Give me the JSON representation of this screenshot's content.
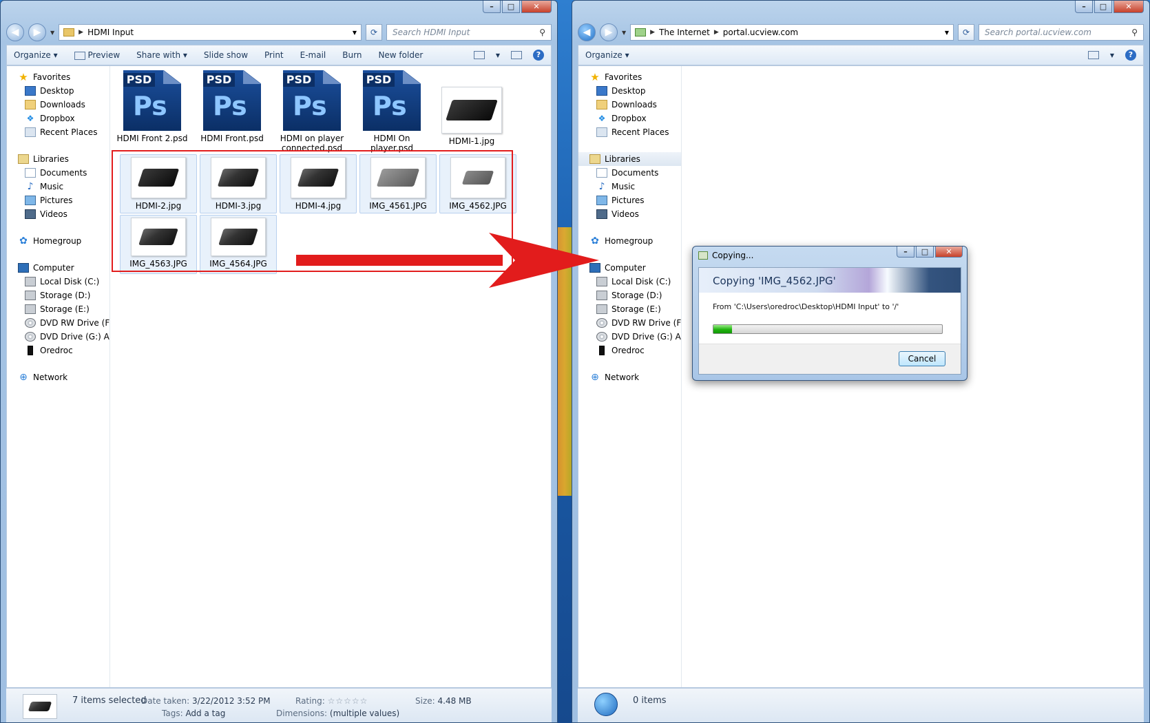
{
  "left": {
    "path": [
      "HDMI Input"
    ],
    "search_placeholder": "Search HDMI Input",
    "toolbar": [
      "Organize ▾",
      "Preview",
      "Share with ▾",
      "Slide show",
      "Print",
      "E-mail",
      "Burn",
      "New folder"
    ],
    "files_row1": [
      {
        "name": "HDMI Front 2.psd",
        "kind": "psd"
      },
      {
        "name": "HDMI Front.psd",
        "kind": "psd"
      },
      {
        "name": "HDMI on player connected.psd",
        "kind": "psd"
      },
      {
        "name": "HDMI On player.psd",
        "kind": "psd"
      },
      {
        "name": "HDMI-1.jpg",
        "kind": "jpg"
      }
    ],
    "files_selected": [
      {
        "name": "HDMI-2.jpg"
      },
      {
        "name": "HDMI-3.jpg"
      },
      {
        "name": "HDMI-4.jpg"
      },
      {
        "name": "IMG_4561.JPG"
      },
      {
        "name": "IMG_4562.JPG"
      },
      {
        "name": "IMG_4563.JPG"
      },
      {
        "name": "IMG_4564.JPG"
      }
    ],
    "status": {
      "selected": "7 items selected",
      "date_label": "Date taken:",
      "date_value": "3/22/2012 3:52 PM",
      "tags_label": "Tags:",
      "tags_value": "Add a tag",
      "rating_label": "Rating:",
      "rating_stars": "☆☆☆☆☆",
      "dims_label": "Dimensions:",
      "dims_value": "(multiple values)",
      "size_label": "Size:",
      "size_value": "4.48 MB"
    }
  },
  "right": {
    "path": [
      "The Internet",
      "portal.ucview.com"
    ],
    "search_placeholder": "Search portal.ucview.com",
    "toolbar": [
      "Organize ▾"
    ],
    "status": {
      "items": "0 items"
    }
  },
  "nav": {
    "favorites": "Favorites",
    "fav_items": [
      "Desktop",
      "Downloads",
      "Dropbox",
      "Recent Places"
    ],
    "libraries": "Libraries",
    "lib_items": [
      "Documents",
      "Music",
      "Pictures",
      "Videos"
    ],
    "homegroup": "Homegroup",
    "computer": "Computer",
    "comp_items": [
      "Local Disk (C:)",
      "Storage (D:)",
      "Storage (E:)",
      "DVD RW Drive (F:)",
      "DVD Drive (G:) ADOBE",
      "Oredroc"
    ],
    "network": "Network"
  },
  "dialog": {
    "title": "Copying...",
    "heading": "Copying 'IMG_4562.JPG'",
    "from": "From 'C:\\Users\\oredroc\\Desktop\\HDMI Input' to '/'",
    "progress": 0.08,
    "cancel": "Cancel"
  },
  "colors": {
    "annotation": "#e21c1c",
    "progress": "#1fb40e"
  }
}
